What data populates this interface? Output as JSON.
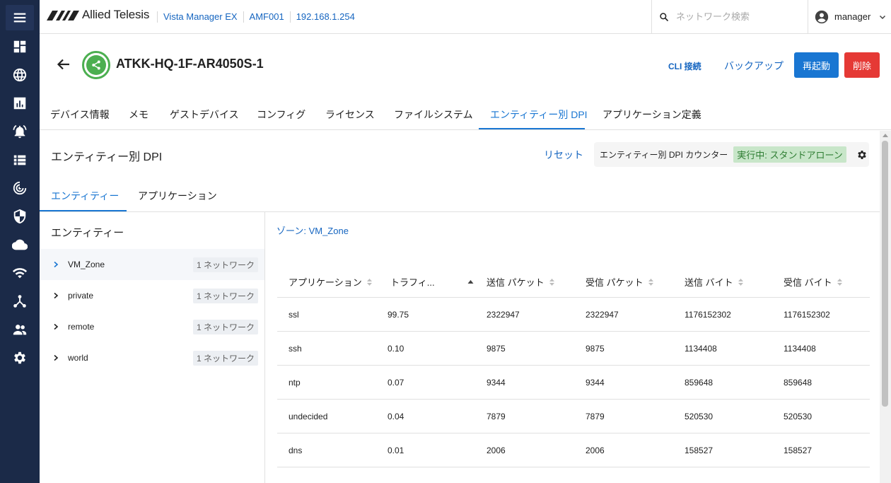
{
  "brand": {
    "name": "Allied Telesis"
  },
  "breadcrumbs": [
    "Vista Manager EX",
    "AMF001",
    "192.168.1.254"
  ],
  "search": {
    "placeholder": "ネットワーク検索",
    "value": ""
  },
  "user": {
    "name": "manager"
  },
  "rail_icons": [
    "menu-icon",
    "dashboard-icon",
    "globe-icon",
    "chart-icon",
    "alarm-bell-icon",
    "list-icon",
    "radar-icon",
    "shield-icon",
    "cloud-icon",
    "wifi-icon",
    "topology-icon",
    "users-icon",
    "settings-gear-icon"
  ],
  "device": {
    "name": "ATKK-HQ-1F-AR4050S-1"
  },
  "actions": {
    "cli": "CLI 接続",
    "backup": "バックアップ",
    "reboot": "再起動",
    "delete": "削除"
  },
  "tabs": [
    "デバイス情報",
    "メモ",
    "ゲストデバイス",
    "コンフィグ",
    "ライセンス",
    "ファイルシステム",
    "エンティティー別 DPI",
    "アプリケーション定義"
  ],
  "active_tab": "エンティティー別 DPI",
  "section": {
    "title": "エンティティー別 DPI",
    "reset": "リセット",
    "counter_label": "エンティティー別 DPI カウンター",
    "counter_status": "実行中: スタンドアローン"
  },
  "subtabs": [
    "エンティティー",
    "アプリケーション"
  ],
  "entities": {
    "heading": "エンティティー",
    "items": [
      {
        "name": "VM_Zone",
        "badge": "1 ネットワーク"
      },
      {
        "name": "private",
        "badge": "1 ネットワーク"
      },
      {
        "name": "remote",
        "badge": "1 ネットワーク"
      },
      {
        "name": "world",
        "badge": "1 ネットワーク"
      }
    ]
  },
  "zone_label": "ゾーン: VM_Zone",
  "table": {
    "headers": [
      "アプリケーション",
      "トラフィ...",
      "送信 パケット",
      "受信 パケット",
      "送信 バイト",
      "受信 バイト"
    ],
    "rows": [
      [
        "ssl",
        "99.75",
        "2322947",
        "2322947",
        "1176152302",
        "1176152302"
      ],
      [
        "ssh",
        "0.10",
        "9875",
        "9875",
        "1134408",
        "1134408"
      ],
      [
        "ntp",
        "0.07",
        "9344",
        "9344",
        "859648",
        "859648"
      ],
      [
        "undecided",
        "0.04",
        "7879",
        "7879",
        "520530",
        "520530"
      ],
      [
        "dns",
        "0.01",
        "2006",
        "2006",
        "158527",
        "158527"
      ]
    ]
  },
  "colors": {
    "rail": "#1b2a48",
    "accent": "#1976d2",
    "danger": "#e53935",
    "device_ok": "#4caf50"
  }
}
